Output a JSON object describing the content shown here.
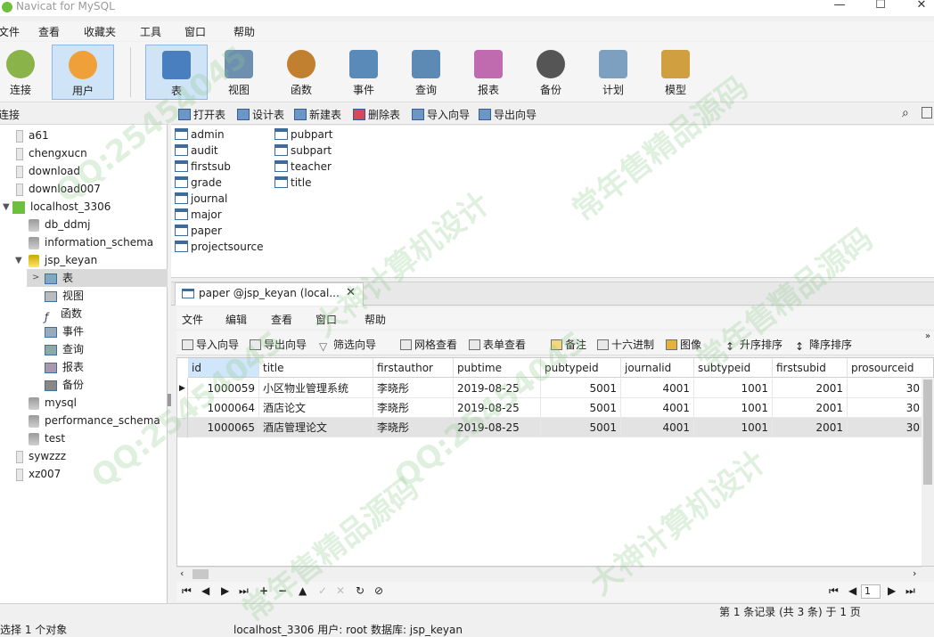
{
  "app": {
    "title": "Navicat for MySQL",
    "min": "—",
    "max": "☐",
    "close": "✕"
  },
  "menubar": [
    "文件",
    "查看",
    "收藏夹",
    "工具",
    "窗口",
    "帮助"
  ],
  "toolbar": [
    {
      "label": "连接",
      "icon": "connect-icon",
      "color": "#8ab34a"
    },
    {
      "label": "用户",
      "icon": "user-icon",
      "color": "#f0a038"
    },
    {
      "label": "表",
      "icon": "table-icon",
      "color": "#4a7fbf",
      "active": true
    },
    {
      "label": "视图",
      "icon": "view-icon",
      "color": "#6f8fb0"
    },
    {
      "label": "函数",
      "icon": "function-icon",
      "color": "#c08030"
    },
    {
      "label": "事件",
      "icon": "event-icon",
      "color": "#5a8ab8"
    },
    {
      "label": "查询",
      "icon": "query-icon",
      "color": "#5d8ab5"
    },
    {
      "label": "报表",
      "icon": "report-icon",
      "color": "#c06ab0"
    },
    {
      "label": "备份",
      "icon": "backup-icon",
      "color": "#555555"
    },
    {
      "label": "计划",
      "icon": "schedule-icon",
      "color": "#7ea0c0"
    },
    {
      "label": "模型",
      "icon": "model-icon",
      "color": "#d0a040"
    }
  ],
  "left": {
    "header": "连接",
    "tree": [
      {
        "label": "a61",
        "level": 0,
        "type": "conn"
      },
      {
        "label": "chengxucn",
        "level": 0,
        "type": "conn"
      },
      {
        "label": "download",
        "level": 0,
        "type": "conn"
      },
      {
        "label": "download007",
        "level": 0,
        "type": "conn"
      },
      {
        "label": "localhost_3306",
        "level": 0,
        "type": "conn-open",
        "expander": "▼"
      },
      {
        "label": "db_ddmj",
        "level": 1,
        "type": "db"
      },
      {
        "label": "information_schema",
        "level": 1,
        "type": "db"
      },
      {
        "label": "jsp_keyan",
        "level": 1,
        "type": "db-open",
        "expander": "▼"
      },
      {
        "label": "表",
        "level": 2,
        "type": "sub",
        "expander": ">",
        "selected": true
      },
      {
        "label": "视图",
        "level": 2,
        "type": "sub"
      },
      {
        "label": "函数",
        "level": 2,
        "type": "sub"
      },
      {
        "label": "事件",
        "level": 2,
        "type": "sub"
      },
      {
        "label": "查询",
        "level": 2,
        "type": "sub"
      },
      {
        "label": "报表",
        "level": 2,
        "type": "sub"
      },
      {
        "label": "备份",
        "level": 2,
        "type": "sub"
      },
      {
        "label": "mysql",
        "level": 1,
        "type": "db"
      },
      {
        "label": "performance_schema",
        "level": 1,
        "type": "db"
      },
      {
        "label": "test",
        "level": 1,
        "type": "db"
      },
      {
        "label": "sywzzz",
        "level": 0,
        "type": "conn"
      },
      {
        "label": "xz007",
        "level": 0,
        "type": "conn"
      }
    ]
  },
  "obj_toolbar": [
    "打开表",
    "设计表",
    "新建表",
    "删除表",
    "导入向导",
    "导出向导"
  ],
  "tables_col1": [
    "admin",
    "audit",
    "firstsub",
    "grade",
    "journal",
    "major",
    "paper",
    "projectsource"
  ],
  "tables_col2": [
    "pubpart",
    "subpart",
    "teacher",
    "title"
  ],
  "tab": {
    "label": "paper @jsp_keyan (local...",
    "close": "✕"
  },
  "inner_menu": [
    "文件",
    "编辑",
    "查看",
    "窗口",
    "帮助"
  ],
  "grid_toolbar": [
    "导入向导",
    "导出向导",
    "筛选向导",
    "网格查看",
    "表单查看",
    "备注",
    "十六进制",
    "图像",
    "升序排序",
    "降序排序"
  ],
  "grid": {
    "columns": [
      "id",
      "title",
      "firstauthor",
      "pubtime",
      "pubtypeid",
      "journalid",
      "subtypeid",
      "firstsubid",
      "prosourceid"
    ],
    "rows": [
      [
        "1000059",
        "小区物业管理系统",
        "李晓彤",
        "2019-08-25",
        "5001",
        "4001",
        "1001",
        "2001",
        "30"
      ],
      [
        "1000064",
        "酒店论文",
        "李晓彤",
        "2019-08-25",
        "5001",
        "4001",
        "1001",
        "2001",
        "30"
      ],
      [
        "1000065",
        "酒店管理论文",
        "李晓彤",
        "2019-08-25",
        "5001",
        "4001",
        "1001",
        "2001",
        "30"
      ]
    ],
    "current_row_marker": "▶"
  },
  "nav": {
    "buttons": [
      "⏮",
      "◀",
      "▶",
      "⏭",
      "+",
      "−",
      "▲",
      "✓",
      "✕",
      "↻",
      "⊘"
    ],
    "page": "1",
    "right_buttons": [
      "⏮",
      "◀",
      "▶",
      "⏭"
    ]
  },
  "status": {
    "records": "第 1 条记录 (共 3 条) 于 1 页",
    "left": "选择 1 个对象",
    "conn": "localhost_3306   用户: root   数据库: jsp_keyan"
  },
  "watermark": [
    "QQ:25454045",
    "大神计算机设计",
    "常年售精品源码",
    "QQ:25454045",
    "常年售精品源码",
    "大神计算机设计",
    "QQ:25454045",
    "常年售精品源码"
  ]
}
